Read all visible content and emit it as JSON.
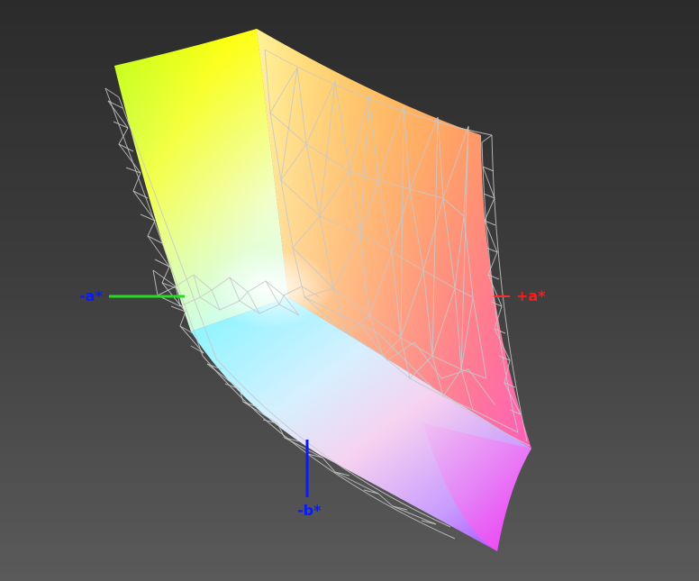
{
  "axes": {
    "neg_a": {
      "label": "-a*",
      "label_color": "#0a1aff",
      "line_color": "#22dd22"
    },
    "pos_a": {
      "label": "+a*",
      "label_color": "#ff1a1a",
      "line_color": "#ff2a2a"
    },
    "neg_b": {
      "label": "-b*",
      "label_color": "#0a1aff",
      "line_color": "#0a1aff"
    }
  },
  "colors": {
    "background_top": "#2b2b2b",
    "background_bottom": "#5a5a5a",
    "wireframe": "#c8c8c8",
    "yellow": "#ffff1a",
    "orange": "#ff7a2a",
    "magenta": "#ff4ad8",
    "violet": "#a83cff",
    "cyan": "#86f4ff",
    "green": "#7dff1a",
    "white": "#fffbe8"
  }
}
